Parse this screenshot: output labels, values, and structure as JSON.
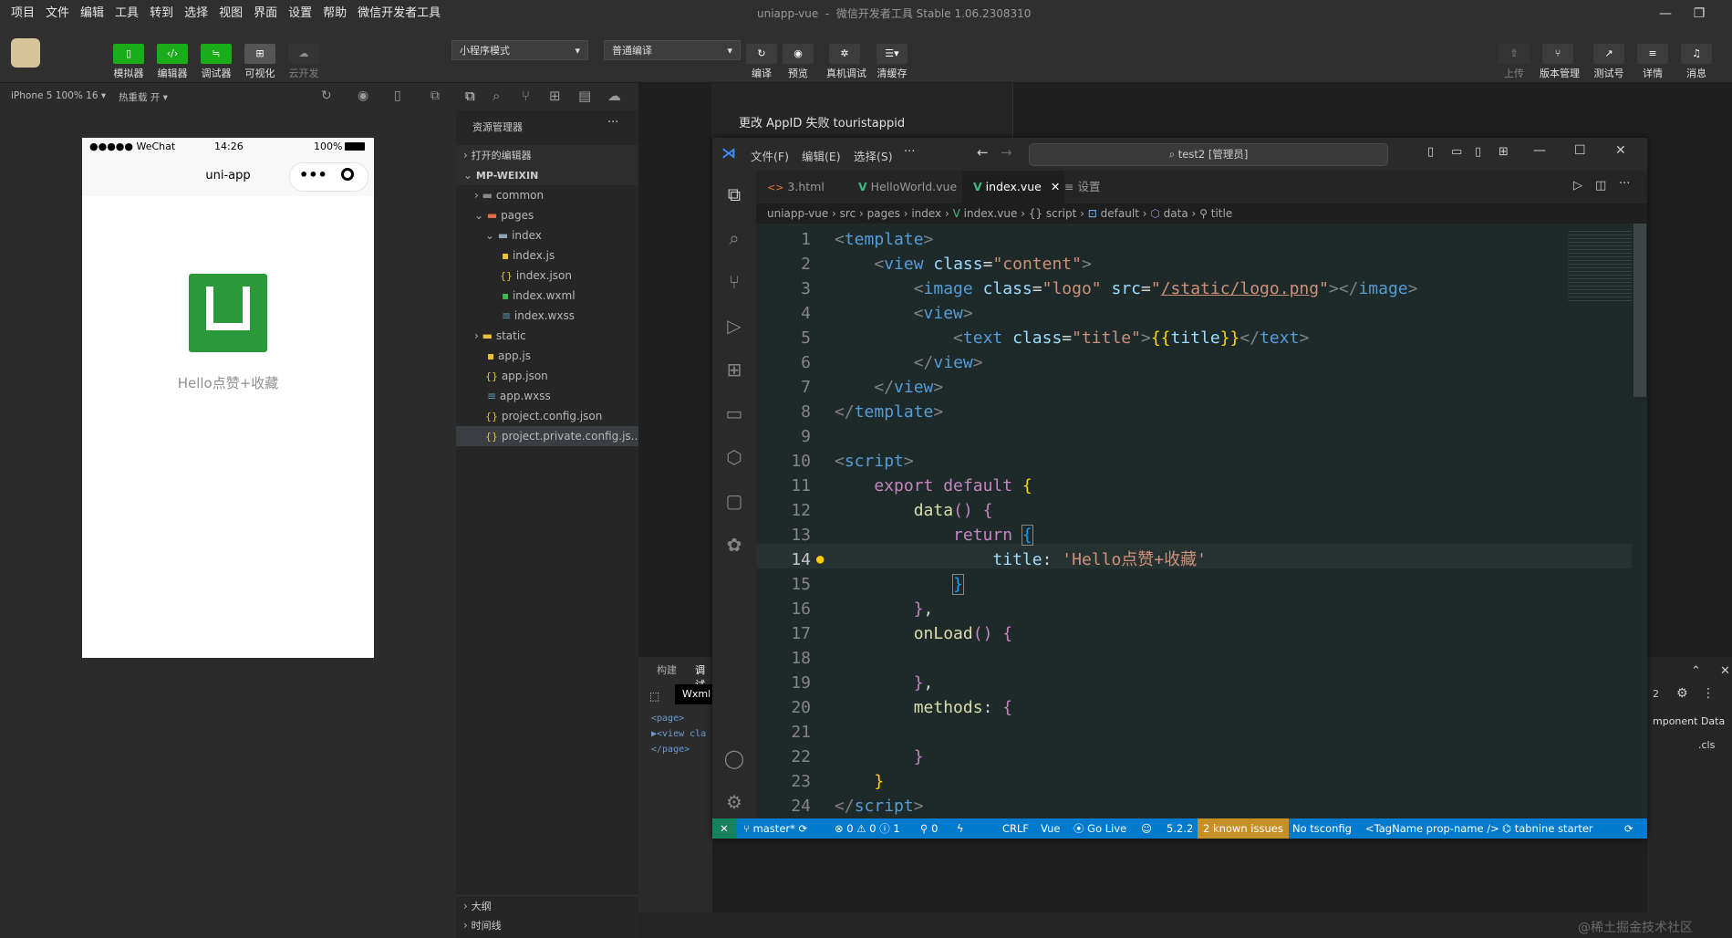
{
  "menubar": {
    "items": [
      "项目",
      "文件",
      "编辑",
      "工具",
      "转到",
      "选择",
      "视图",
      "界面",
      "设置",
      "帮助",
      "微信开发者工具"
    ],
    "title_app": "uniapp-vue",
    "title_rest": "微信开发者工具 Stable 1.06.2308310"
  },
  "toolbar": {
    "simulator": "模拟器",
    "editor": "编辑器",
    "debugger": "调试器",
    "visual": "可视化",
    "cloud": "云开发",
    "mode_select": "小程序模式",
    "compile_select": "普通编译",
    "compile": "编译",
    "preview": "预览",
    "remote_debug": "真机调试",
    "clear_cache": "清缓存",
    "upload": "上传",
    "version": "版本管理",
    "test": "测试号",
    "details": "详情",
    "messages": "消息"
  },
  "simbar": {
    "device": "iPhone 5 100% 16 ▾",
    "hotreload": "热重载 开 ▾"
  },
  "phone": {
    "signal": "●●●●● WeChat",
    "time": "14:26",
    "battery": "100%",
    "nav_title": "uni-app",
    "logo_letter": "U",
    "text": "Hello点赞+收藏"
  },
  "explorer": {
    "title": "资源管理器",
    "more": "···",
    "open_editors": "打开的编辑器",
    "root": "MP-WEIXIN",
    "items": [
      {
        "name": "common",
        "type": "folder"
      },
      {
        "name": "pages",
        "type": "folder-open"
      },
      {
        "name": "index",
        "type": "folder-open"
      },
      {
        "name": "index.js",
        "type": "js"
      },
      {
        "name": "index.json",
        "type": "json"
      },
      {
        "name": "index.wxml",
        "type": "wxml"
      },
      {
        "name": "index.wxss",
        "type": "wxss"
      },
      {
        "name": "static",
        "type": "folder"
      },
      {
        "name": "app.js",
        "type": "js"
      },
      {
        "name": "app.json",
        "type": "json"
      },
      {
        "name": "app.wxss",
        "type": "wxss"
      },
      {
        "name": "project.config.json",
        "type": "json"
      },
      {
        "name": "project.private.config.js...",
        "type": "json"
      }
    ],
    "outline": "大纲",
    "timeline": "时间线"
  },
  "mid": {
    "notice": "更改 AppID 失败 touristappid"
  },
  "vscode": {
    "menu": [
      "文件(F)",
      "编辑(E)",
      "选择(S)",
      "···"
    ],
    "search": "test2 [管理员]",
    "tabs": [
      {
        "label": "3.html",
        "icon": "<>"
      },
      {
        "label": "HelloWorld.vue",
        "icon": "V"
      },
      {
        "label": "index.vue",
        "icon": "V"
      },
      {
        "label": "设置",
        "icon": "≡"
      }
    ],
    "breadcrumbs": [
      "uniapp-vue",
      "src",
      "pages",
      "index",
      "index.vue",
      "{} script",
      "default",
      "data",
      "title"
    ],
    "status": {
      "branch": "master*",
      "errors": "⊗ 0 ⚠ 0 ⓘ 1",
      "ports": "⚲ 0",
      "eol": "CRLF",
      "lang": "Vue",
      "golive": "Go Live",
      "version": "5.2.2",
      "issues": "2 known issues",
      "tsconfig": "No tsconfig",
      "tagname": "<TagName prop-name />",
      "tabnine": "tabnine starter"
    }
  },
  "code": [
    {
      "n": "1"
    },
    {
      "n": "2"
    },
    {
      "n": "3"
    },
    {
      "n": "4"
    },
    {
      "n": "5"
    },
    {
      "n": "6"
    },
    {
      "n": "7"
    },
    {
      "n": "8"
    },
    {
      "n": "9"
    },
    {
      "n": "10"
    },
    {
      "n": "11"
    },
    {
      "n": "12"
    },
    {
      "n": "13"
    },
    {
      "n": "14"
    },
    {
      "n": "15"
    },
    {
      "n": "16"
    },
    {
      "n": "17"
    },
    {
      "n": "18"
    },
    {
      "n": "19"
    },
    {
      "n": "20"
    },
    {
      "n": "21"
    },
    {
      "n": "22"
    },
    {
      "n": "23"
    },
    {
      "n": "24"
    }
  ],
  "devtools": {
    "tab1": "构建",
    "tab2": "调试",
    "wxml": "Wxml",
    "line1": "<page>",
    "line2": "▶<view cla",
    "line3": "</page>",
    "right_count": "2",
    "right_title": "mponent Data",
    "right_cls": ".cls"
  },
  "watermark": "@稀土掘金技术社区"
}
